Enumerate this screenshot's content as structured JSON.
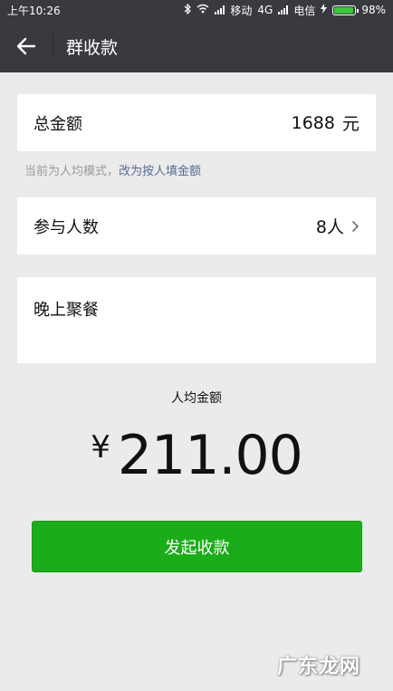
{
  "status_bar": {
    "time": "上午10:26",
    "carrier1": "移动",
    "network": "4G",
    "carrier2": "电信",
    "battery": "98%"
  },
  "nav": {
    "title": "群收款"
  },
  "total": {
    "label": "总金额",
    "value": "1688",
    "unit": "元"
  },
  "mode_hint": {
    "text": "当前为人均模式，",
    "link": "改为按人填金额"
  },
  "participants": {
    "label": "参与人数",
    "value": "8人"
  },
  "note": {
    "text": "晚上聚餐"
  },
  "average": {
    "label": "人均金额",
    "currency": "¥",
    "amount": "211.00"
  },
  "submit": {
    "label": "发起收款"
  },
  "watermark": {
    "text": "广东龙网"
  },
  "colors": {
    "nav_bg": "#393a3f",
    "primary_green": "#1aad19",
    "link": "#576b95"
  }
}
